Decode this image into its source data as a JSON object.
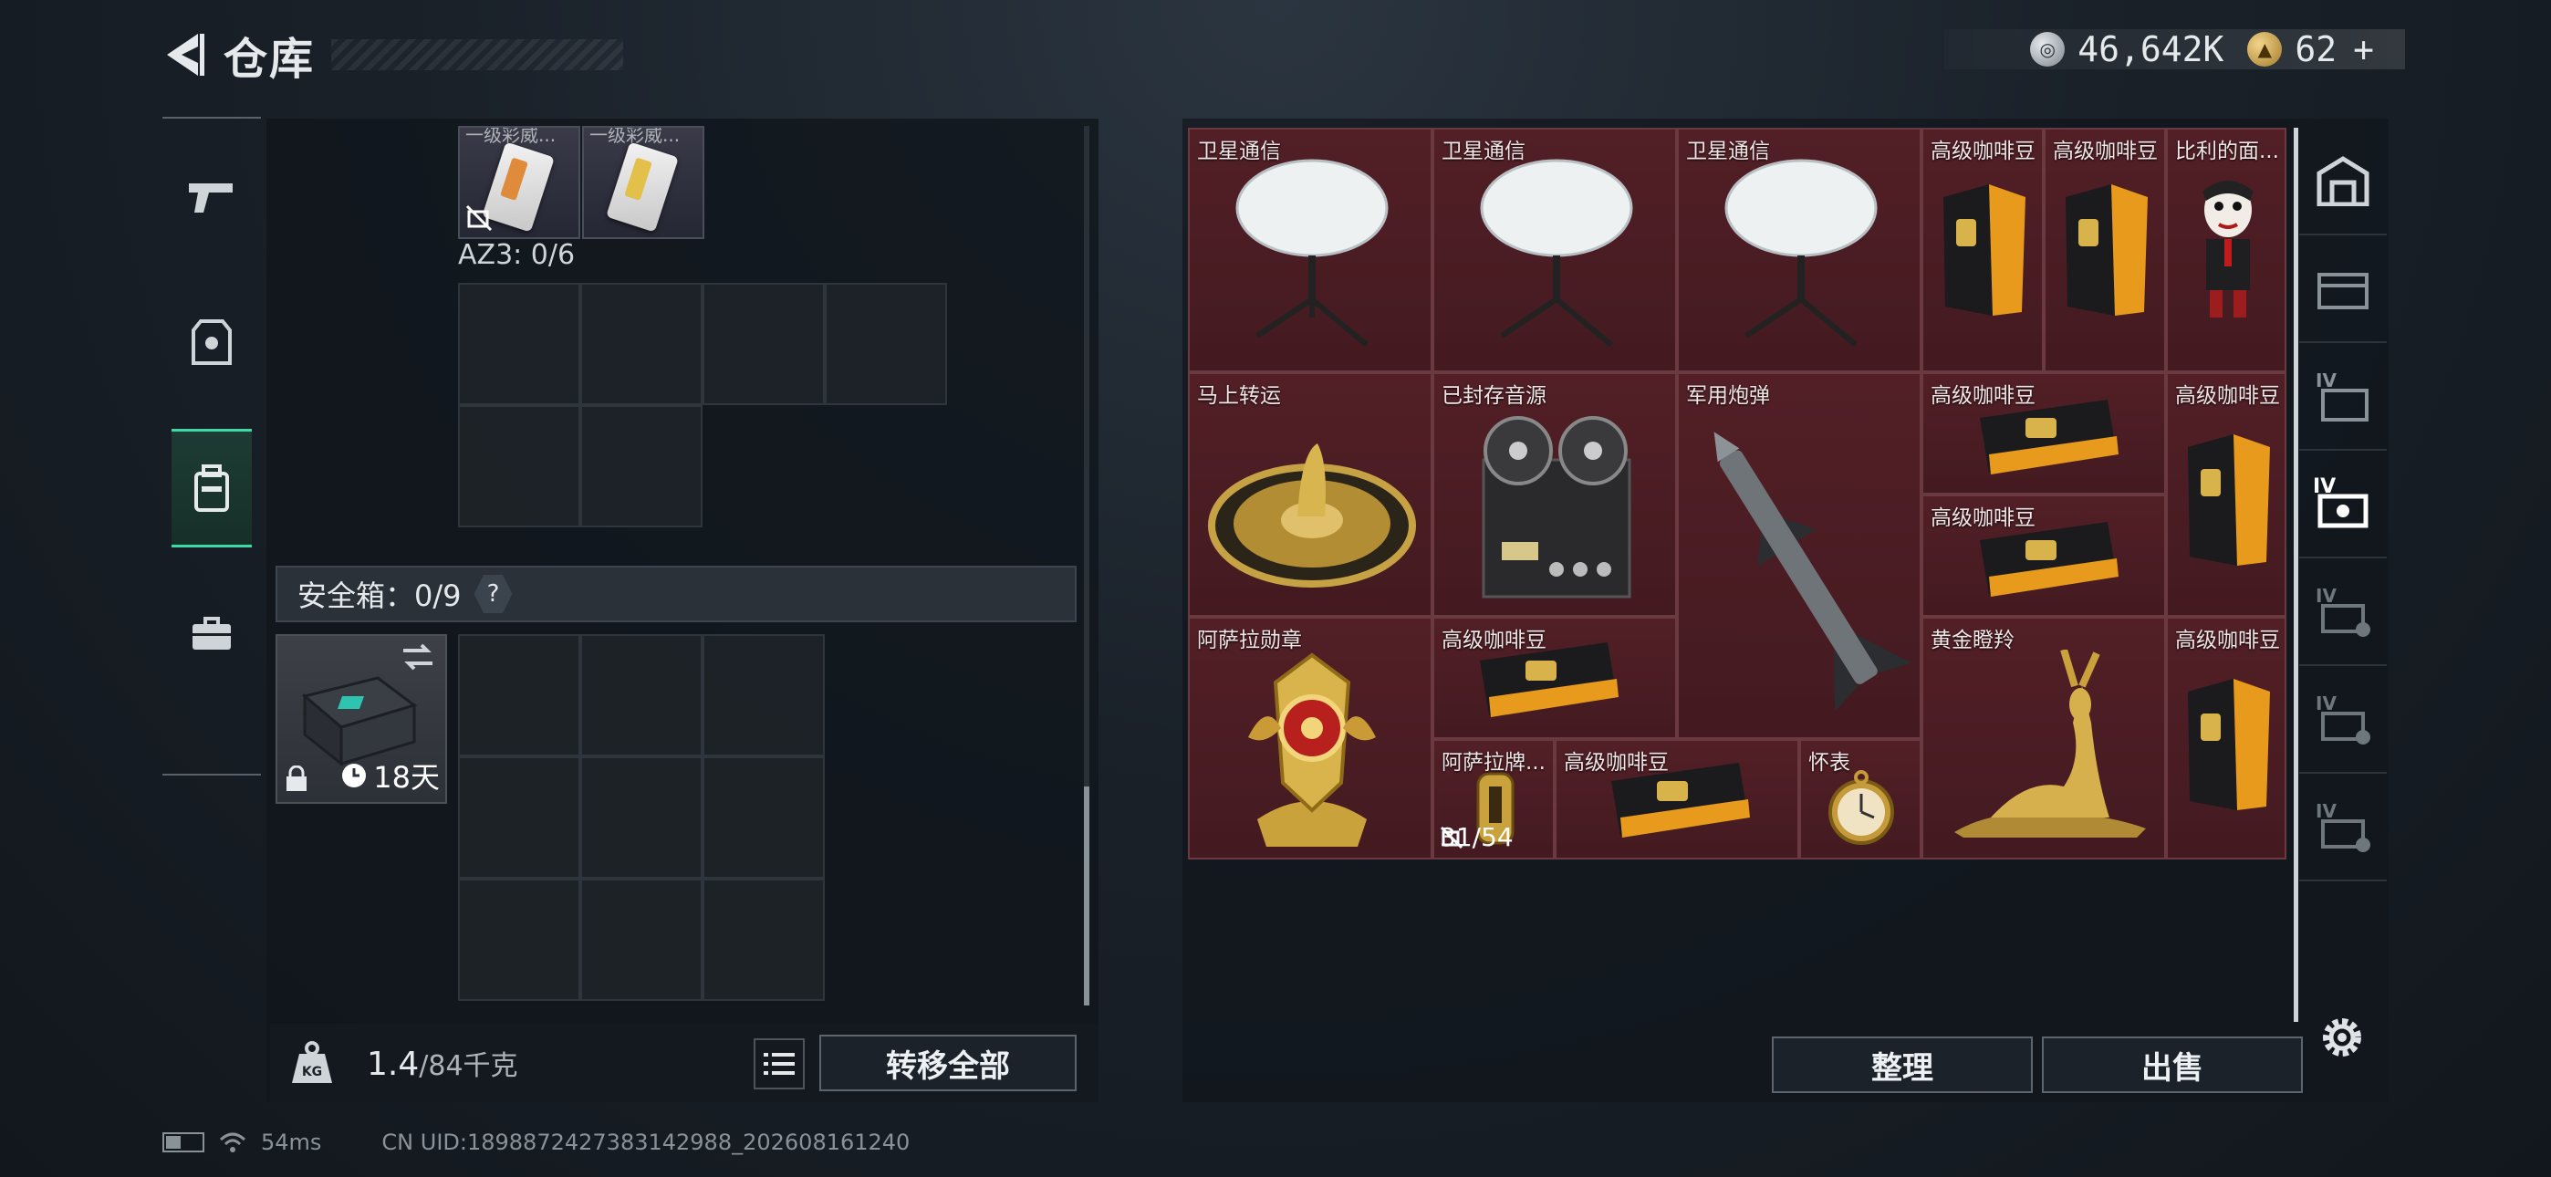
{
  "header": {
    "title": "仓库"
  },
  "currency": {
    "silver_value": "46,642K",
    "gold_value": "62",
    "gold_plus": "+"
  },
  "sidebar": {
    "categories": [
      "pistol-icon",
      "armor-icon",
      "backpack-icon",
      "briefcase-icon"
    ],
    "active_index": 2
  },
  "left_panel": {
    "slot_items": [
      {
        "label": "一级彩威...",
        "card": "orange"
      },
      {
        "label": "一级彩威...",
        "card": "yellow"
      }
    ],
    "az_label": "AZ3: 0/6",
    "safe_box_label": "安全箱：0/9",
    "help": "?",
    "safebox_days": "18天",
    "weight_current": "1.4",
    "weight_max": "/84千克",
    "transfer_all": "转移全部"
  },
  "inventory": {
    "items": [
      {
        "label": "卫星通信",
        "kind": "dish"
      },
      {
        "label": "卫星通信",
        "kind": "dish"
      },
      {
        "label": "卫星通信",
        "kind": "dish"
      },
      {
        "label": "高级咖啡豆",
        "kind": "coffee-bag"
      },
      {
        "label": "高级咖啡豆",
        "kind": "coffee-bag"
      },
      {
        "label": "比利的面...",
        "kind": "doll"
      },
      {
        "label": "马上转运",
        "kind": "disc"
      },
      {
        "label": "已封存音源",
        "kind": "tape-recorder"
      },
      {
        "label": "军用炮弹",
        "kind": "missile"
      },
      {
        "label": "高级咖啡豆",
        "kind": "coffee-flat"
      },
      {
        "label": "高级咖啡豆",
        "kind": "coffee-bag"
      },
      {
        "label": "高级咖啡豆",
        "kind": "coffee-flat"
      },
      {
        "label": "阿萨拉勋章",
        "kind": "medal"
      },
      {
        "label": "高级咖啡豆",
        "kind": "coffee-flat"
      },
      {
        "label": "黄金瞪羚",
        "kind": "gazelle"
      },
      {
        "label": "高级咖啡豆",
        "kind": "coffee-bag"
      },
      {
        "label": "阿萨拉牌...",
        "kind": "lighter",
        "counter": "31/54"
      },
      {
        "label": "高级咖啡豆",
        "kind": "coffee-flat"
      },
      {
        "label": "怀表",
        "kind": "pocket-watch"
      }
    ],
    "sort_label": "整理",
    "sell_label": "出售"
  },
  "right_sidebar": {
    "items": [
      "safe-icon",
      "crate-icon",
      "container-iv-icon",
      "container-iv-active-icon",
      "container-iv-locked-icon",
      "container-iv-locked-icon",
      "container-iv-locked-icon"
    ]
  },
  "status": {
    "ping": "54ms",
    "uid": "CN UID:1898872427383142988_202608161240"
  },
  "colors": {
    "accent": "#3fd9a6",
    "item_bg": "#4a1e24"
  }
}
